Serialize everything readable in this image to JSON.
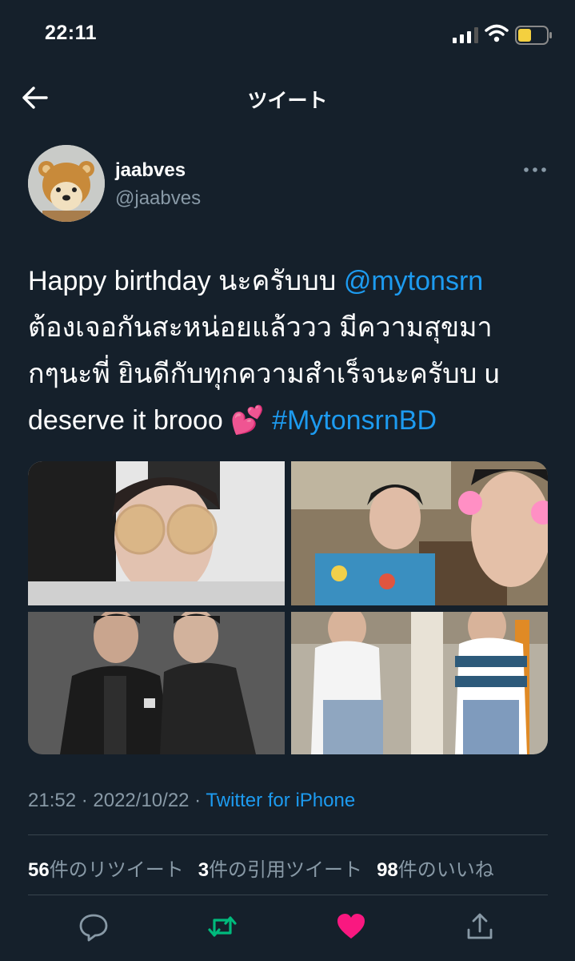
{
  "status_bar": {
    "time": "22:11"
  },
  "nav": {
    "title": "ツイート"
  },
  "author": {
    "name": "jaabves",
    "handle": "@jaabves"
  },
  "tweet": {
    "line1_text": "Happy birthday นะครับบบ ",
    "line1_mention": "@mytonsrn",
    "line2": "ต้องเจอกันสะหน่อยแล้ววว มีความสุขมา",
    "line3": "กๆนะพี่ ยินดีกับทุกความสำเร็จนะครับบ u",
    "line4_text": "deserve it brooo ",
    "line4_emoji": "💕",
    "line4_hashtag": "#MytonsrnBD"
  },
  "meta": {
    "time": "21:52",
    "date": "2022/10/22",
    "separator": " · ",
    "source": "Twitter for iPhone"
  },
  "stats": {
    "retweets_count": "56",
    "retweets_label": "件のリツイート",
    "quotes_count": "3",
    "quotes_label": "件の引用ツイート",
    "likes_count": "98",
    "likes_label": "件のいいね"
  },
  "icons": {
    "reply": "reply-icon",
    "retweet": "retweet-icon",
    "like": "heart-icon",
    "share": "share-icon"
  },
  "colors": {
    "background": "#15202b",
    "link": "#1d9bf0",
    "muted": "#8899a6",
    "retweet_active": "#00ba7c",
    "like_active": "#f91880",
    "battery": "#f4d03f"
  }
}
